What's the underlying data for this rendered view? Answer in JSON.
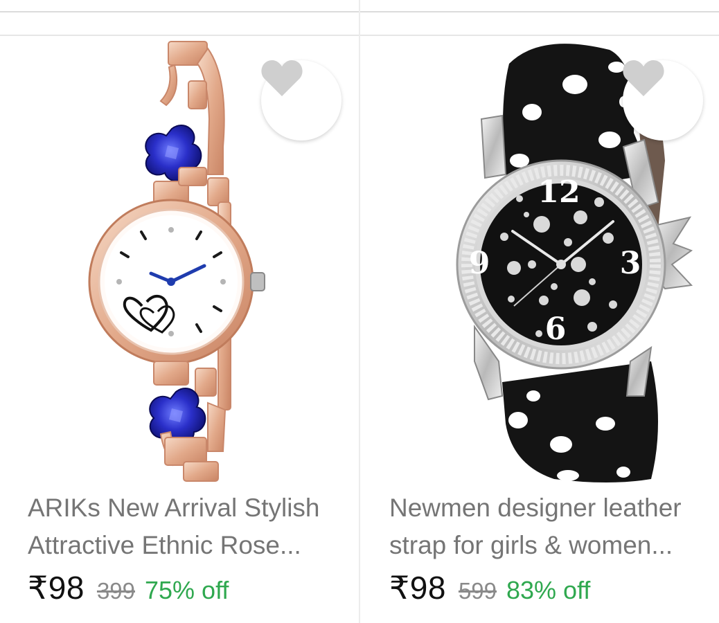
{
  "products": [
    {
      "title_line1": "ARIKs New Arrival Stylish",
      "title_line2": "Attractive Ethnic Rose...",
      "price": "₹98",
      "mrp": "399",
      "discount": "75% off",
      "image_icon": "rose-gold-bracelet-watch-image"
    },
    {
      "title_line1": "Newmen designer leather",
      "title_line2": "strap for girls & women...",
      "price": "₹98",
      "mrp": "599",
      "discount": "83% off",
      "image_icon": "polka-dot-leather-watch-image"
    }
  ],
  "dial_numerals": {
    "twelve": "12",
    "three": "3",
    "six": "6",
    "nine": "9"
  },
  "wishlist_icon": "heart-icon",
  "colors": {
    "discount_green": "#2fa84f",
    "heart_gray": "#cfcfcf",
    "title_gray": "#757575"
  }
}
